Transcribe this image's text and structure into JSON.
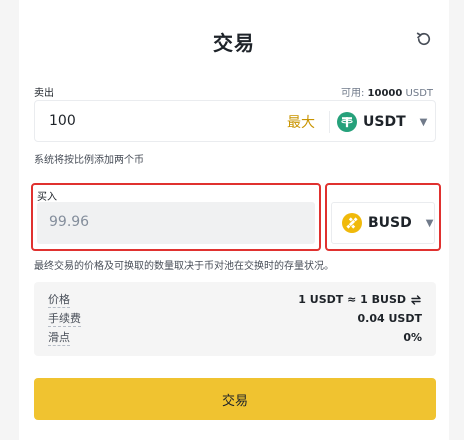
{
  "header": {
    "title": "交易"
  },
  "sell": {
    "label": "卖出",
    "available_prefix": "可用: ",
    "available_amount": "10000",
    "available_unit": " USDT",
    "amount": "100",
    "max_label": "最大",
    "coin": "USDT",
    "hint": "系统将按比例添加两个币"
  },
  "buy": {
    "label": "买入",
    "amount": "99.96",
    "coin": "BUSD",
    "hint": "最终交易的价格及可换取的数量取决于币对池在交换时的存量状况。"
  },
  "info": {
    "rows": [
      {
        "key": "价格",
        "value": "1 USDT ≈ 1 BUSD"
      },
      {
        "key": "手续费",
        "value": "0.04 USDT"
      },
      {
        "key": "滑点",
        "value": "0%"
      }
    ]
  },
  "action": {
    "trade_label": "交易"
  },
  "colors": {
    "accent": "#f0c330",
    "max_text": "#c99400",
    "highlight": "#e0312f",
    "usdt": "#26a17b",
    "busd": "#f0b90b"
  }
}
